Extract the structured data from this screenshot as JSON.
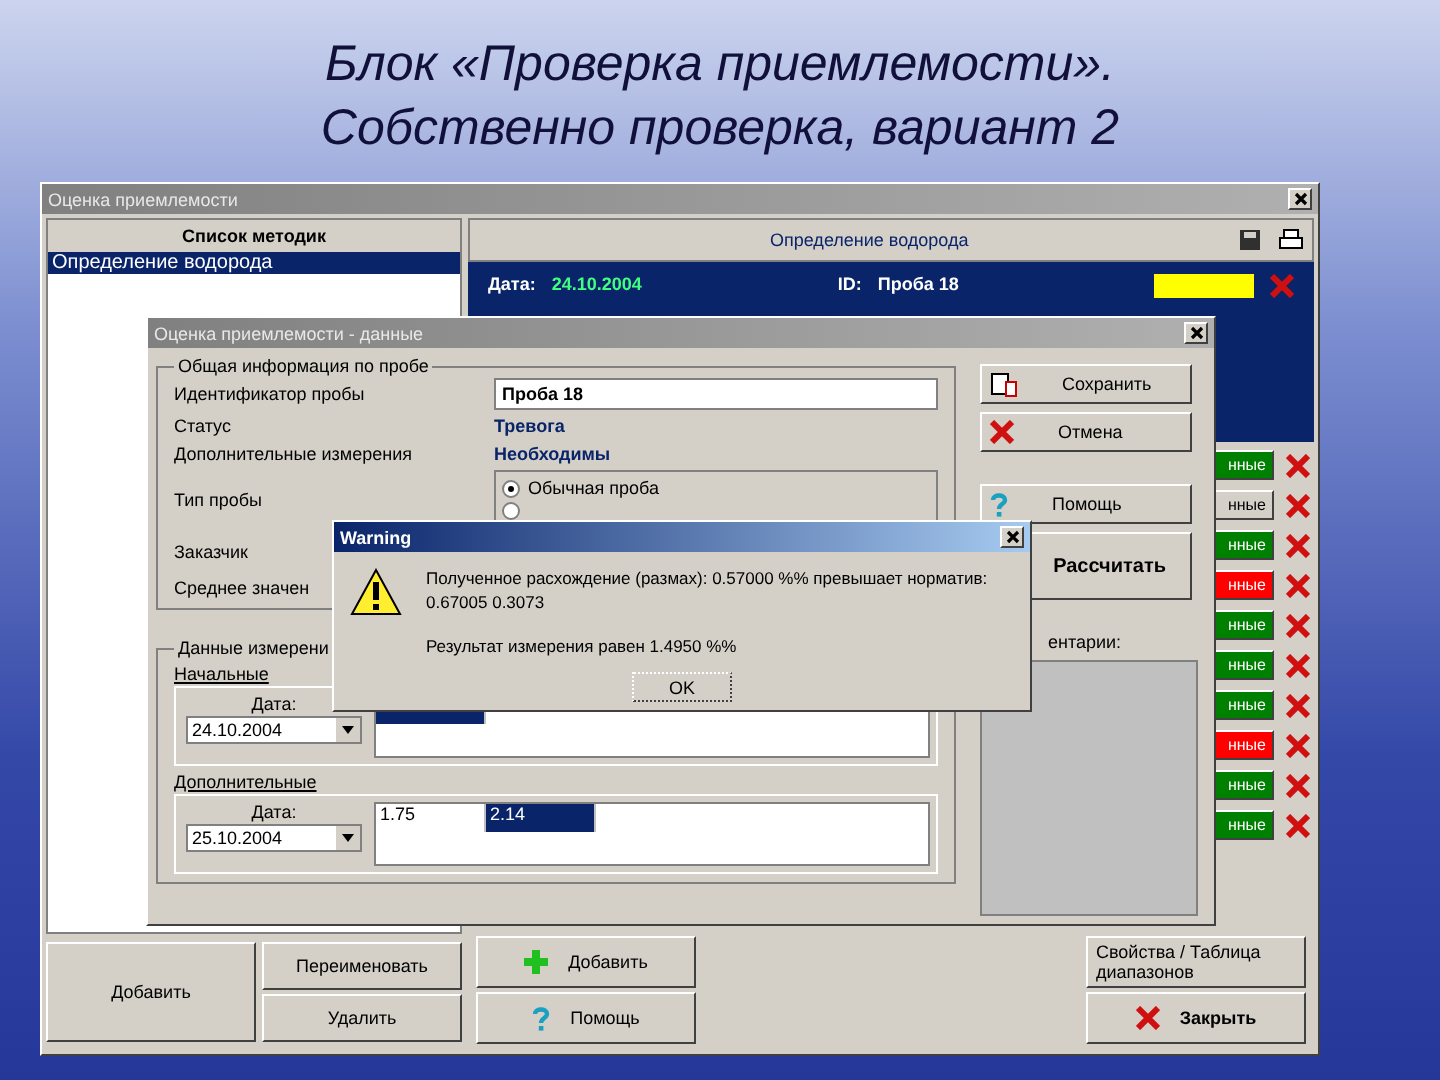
{
  "slide": {
    "title_line_1": "Блок «Проверка приемлемости».",
    "title_line_2": "Собственно проверка, вариант 2"
  },
  "main_window": {
    "title": "Оценка приемлемости",
    "methods": {
      "header": "Список методик",
      "items": [
        {
          "label": "Определение водорода",
          "selected": true
        }
      ]
    },
    "method_panel": {
      "header": "Определение водорода",
      "date_label": "Дата:",
      "date": "24.10.2004",
      "id_label": "ID:",
      "id": "Проба 18"
    },
    "status_chips": [
      {
        "label": "нные",
        "color": "#008000"
      },
      {
        "label": "нные",
        "color": "#d4d0c8"
      },
      {
        "label": "нные",
        "color": "#008000"
      },
      {
        "label": "нные",
        "color": "#ff0000"
      },
      {
        "label": "нные",
        "color": "#008000"
      },
      {
        "label": "нные",
        "color": "#008000"
      },
      {
        "label": "нные",
        "color": "#008000"
      },
      {
        "label": "нные",
        "color": "#ff0000"
      },
      {
        "label": "нные",
        "color": "#008000"
      },
      {
        "label": "нные",
        "color": "#008000"
      }
    ],
    "left_buttons": [
      "Добавить",
      "Переименовать",
      "Удалить"
    ],
    "right_buttons": {
      "add": "Добавить",
      "properties": "Свойства / Таблица диапазонов",
      "help": "Помощь",
      "close": "Закрыть"
    }
  },
  "data_dialog": {
    "title": "Оценка приемлемости - данные",
    "general": {
      "legend": "Общая информация по пробе",
      "id_label": "Идентификатор пробы",
      "id_value": "Проба 18",
      "status_label": "Статус",
      "status_value": "Тревога",
      "extra_label": "Дополнительные измерения",
      "extra_value": "Необходимы",
      "type_label": "Тип пробы",
      "types": [
        {
          "label": "Обычная проба",
          "selected": true
        },
        {
          "selected": false
        }
      ],
      "customer_label": "Заказчик",
      "mean_label": "Среднее значен"
    },
    "measurements": {
      "legend": "Данные измерени",
      "sections": [
        {
          "title": "Начальные",
          "date_label": "Дата:",
          "date": "24.10.2004",
          "cells": [
            {
              "selected": true
            }
          ]
        },
        {
          "title": "Дополнительные",
          "date_label": "Дата:",
          "date": "25.10.2004",
          "cells": [
            {
              "value": "1.75",
              "selected": false
            },
            {
              "value": "2.14",
              "selected": true
            }
          ]
        }
      ]
    },
    "buttons": {
      "save": "Сохранить",
      "cancel": "Отмена",
      "help": "Помощь",
      "calculate": "Рассчитать"
    },
    "comments_label": "ентарии:"
  },
  "warning": {
    "title": "Warning",
    "message_line_1": "Полученное расхождение (размах): 0.57000 %% превышает норматив:",
    "message_line_2": "0.67005 0.3073",
    "result": "Результат измерения равен 1.4950 %%",
    "ok": "OK"
  }
}
